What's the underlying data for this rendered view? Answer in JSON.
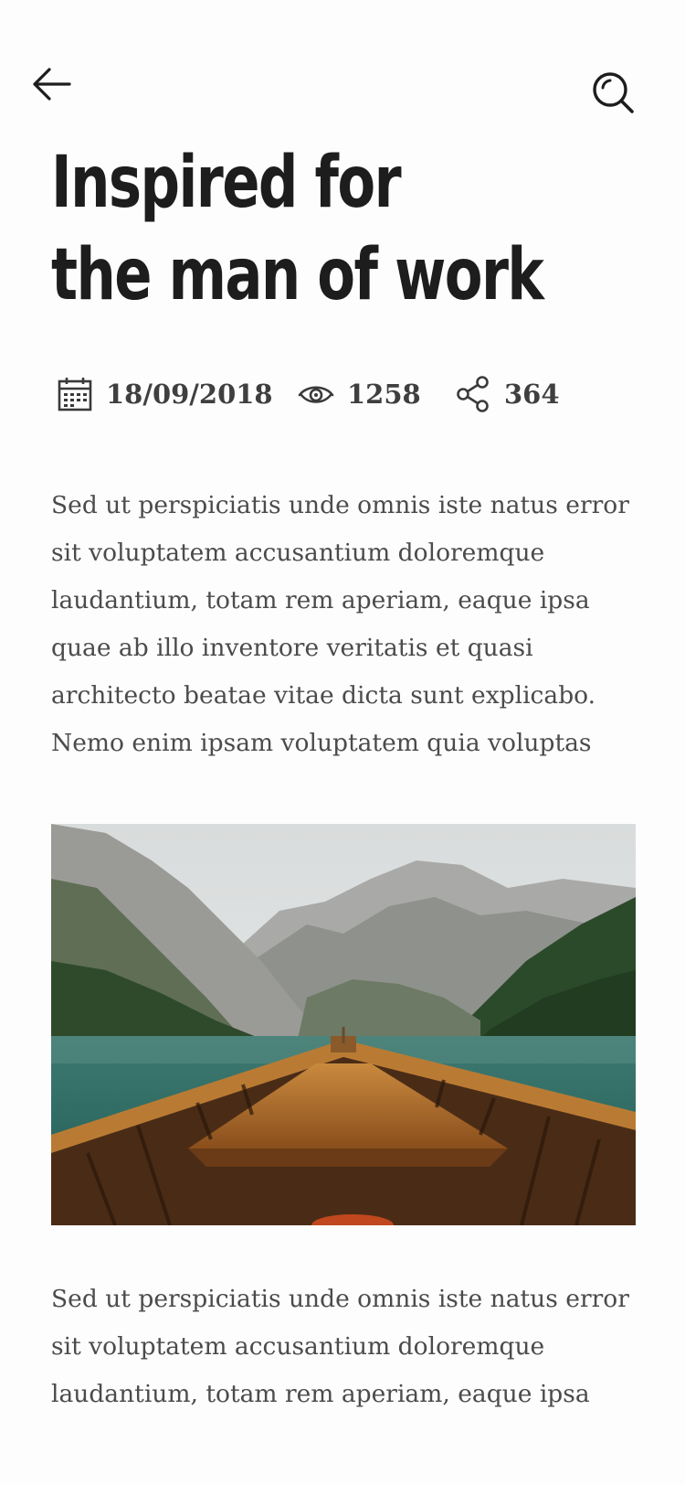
{
  "header": {
    "back_icon": "arrow-left-icon",
    "search_icon": "search-icon"
  },
  "article": {
    "title_lines": [
      "Inspired for",
      "the man of work"
    ],
    "meta": {
      "date": "18/09/2018",
      "date_icon": "calendar-icon",
      "views": "1258",
      "views_icon": "eye-icon",
      "shares": "364",
      "shares_icon": "share-icon"
    },
    "paragraph1_lines": [
      "Sed ut perspiciatis unde omnis iste natus error",
      "sit voluptatem accusantium doloremque",
      "laudantium, totam rem aperiam, eaque ipsa",
      "quae ab illo inventore veritatis et quasi",
      "architecto beatae vitae dicta sunt explicabo.",
      "Nemo enim ipsam voluptatem quia voluptas"
    ],
    "paragraph2_lines": [
      "Sed ut perspiciatis unde omnis iste natus error",
      "sit voluptatem accusantium doloremque",
      "laudantium, totam rem aperiam, eaque ipsa"
    ]
  },
  "colors": {
    "background": "#fdfdfd",
    "title": "#1d1d1d",
    "body_text": "#4b4b4b",
    "meta_text": "#3f3f3f",
    "icon": "#3a3a3a"
  }
}
